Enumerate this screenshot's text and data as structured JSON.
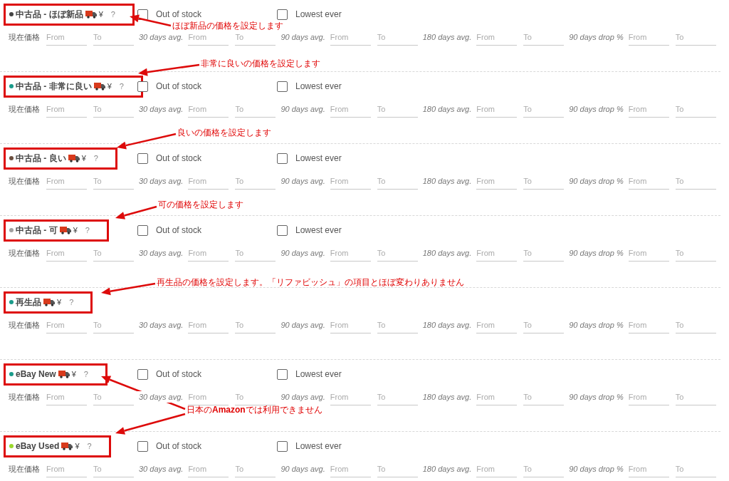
{
  "sections": [
    {
      "label": "中古品 - ほぼ新品",
      "color": "#444444",
      "currency": "¥",
      "help": "?",
      "out_of_stock": {
        "label": "Out of stock",
        "checked": false
      },
      "lowest_ever": {
        "label": "Lowest ever",
        "checked": false
      },
      "row_label": "現在価格",
      "ranges": [
        {
          "fields": [
            {
              "placeholder": "From"
            },
            {
              "placeholder": "To"
            }
          ]
        },
        {
          "label": "30 days avg.",
          "fields": [
            {
              "placeholder": "From"
            },
            {
              "placeholder": "To"
            }
          ]
        },
        {
          "label": "90 days avg.",
          "fields": [
            {
              "placeholder": "From"
            },
            {
              "placeholder": "To"
            }
          ]
        },
        {
          "label": "180 days avg.",
          "fields": [
            {
              "placeholder": "From"
            },
            {
              "placeholder": "To"
            }
          ]
        },
        {
          "label": "90 days drop %",
          "fields": [
            {
              "placeholder": "From"
            },
            {
              "placeholder": "To"
            }
          ]
        }
      ]
    },
    {
      "label": "中古品 - 非常に良い",
      "color": "#1a9b8a",
      "currency": "¥",
      "help": "?",
      "out_of_stock": {
        "label": "Out of stock",
        "checked": false
      },
      "lowest_ever": {
        "label": "Lowest ever",
        "checked": false
      },
      "row_label": "現在価格",
      "ranges": [
        {
          "fields": [
            {
              "placeholder": "From"
            },
            {
              "placeholder": "To"
            }
          ]
        },
        {
          "label": "30 days avg.",
          "fields": [
            {
              "placeholder": "From"
            },
            {
              "placeholder": "To"
            }
          ]
        },
        {
          "label": "90 days avg.",
          "fields": [
            {
              "placeholder": "From"
            },
            {
              "placeholder": "To"
            }
          ]
        },
        {
          "label": "180 days avg.",
          "fields": [
            {
              "placeholder": "From"
            },
            {
              "placeholder": "To"
            }
          ]
        },
        {
          "label": "90 days drop %",
          "fields": [
            {
              "placeholder": "From"
            },
            {
              "placeholder": "To"
            }
          ]
        }
      ]
    },
    {
      "label": "中古品 - 良い",
      "color": "#6b4f3f",
      "currency": "¥",
      "help": "?",
      "out_of_stock": {
        "label": "Out of stock",
        "checked": false
      },
      "lowest_ever": {
        "label": "Lowest ever",
        "checked": false
      },
      "row_label": "現在価格",
      "ranges": [
        {
          "fields": [
            {
              "placeholder": "From"
            },
            {
              "placeholder": "To"
            }
          ]
        },
        {
          "label": "30 days avg.",
          "fields": [
            {
              "placeholder": "From"
            },
            {
              "placeholder": "To"
            }
          ]
        },
        {
          "label": "90 days avg.",
          "fields": [
            {
              "placeholder": "From"
            },
            {
              "placeholder": "To"
            }
          ]
        },
        {
          "label": "180 days avg.",
          "fields": [
            {
              "placeholder": "From"
            },
            {
              "placeholder": "To"
            }
          ]
        },
        {
          "label": "90 days drop %",
          "fields": [
            {
              "placeholder": "From"
            },
            {
              "placeholder": "To"
            }
          ]
        }
      ]
    },
    {
      "label": "中古品 - 可",
      "color": "#a0a0a0",
      "currency": "¥",
      "help": "?",
      "out_of_stock": {
        "label": "Out of stock",
        "checked": false
      },
      "lowest_ever": {
        "label": "Lowest ever",
        "checked": false
      },
      "row_label": "現在価格",
      "ranges": [
        {
          "fields": [
            {
              "placeholder": "From"
            },
            {
              "placeholder": "To"
            }
          ]
        },
        {
          "label": "30 days avg.",
          "fields": [
            {
              "placeholder": "From"
            },
            {
              "placeholder": "To"
            }
          ]
        },
        {
          "label": "90 days avg.",
          "fields": [
            {
              "placeholder": "From"
            },
            {
              "placeholder": "To"
            }
          ]
        },
        {
          "label": "180 days avg.",
          "fields": [
            {
              "placeholder": "From"
            },
            {
              "placeholder": "To"
            }
          ]
        },
        {
          "label": "90 days drop %",
          "fields": [
            {
              "placeholder": "From"
            },
            {
              "placeholder": "To"
            }
          ]
        }
      ]
    },
    {
      "label": "再生品",
      "color": "#1a9b8a",
      "currency": "¥",
      "help": "?",
      "row_label": "現在価格",
      "ranges": [
        {
          "fields": [
            {
              "placeholder": "From"
            },
            {
              "placeholder": "To"
            }
          ]
        },
        {
          "label": "30 days avg.",
          "fields": [
            {
              "placeholder": "From"
            },
            {
              "placeholder": "To"
            }
          ]
        },
        {
          "label": "90 days avg.",
          "fields": [
            {
              "placeholder": "From"
            },
            {
              "placeholder": "To"
            }
          ]
        },
        {
          "label": "180 days avg.",
          "fields": [
            {
              "placeholder": "From"
            },
            {
              "placeholder": "To"
            }
          ]
        },
        {
          "label": "90 days drop %",
          "fields": [
            {
              "placeholder": "From"
            },
            {
              "placeholder": "To"
            }
          ]
        }
      ]
    },
    {
      "label": "eBay New",
      "color": "#1a9b8a",
      "currency": "¥",
      "help": "?",
      "out_of_stock": {
        "label": "Out of stock",
        "checked": false
      },
      "lowest_ever": {
        "label": "Lowest ever",
        "checked": false
      },
      "row_label": "現在価格",
      "ranges": [
        {
          "fields": [
            {
              "placeholder": "From"
            },
            {
              "placeholder": "To"
            }
          ]
        },
        {
          "label": "30 days avg.",
          "fields": [
            {
              "placeholder": "From"
            },
            {
              "placeholder": "To"
            }
          ]
        },
        {
          "label": "90 days avg.",
          "fields": [
            {
              "placeholder": "From"
            },
            {
              "placeholder": "To"
            }
          ]
        },
        {
          "label": "180 days avg.",
          "fields": [
            {
              "placeholder": "From"
            },
            {
              "placeholder": "To"
            }
          ]
        },
        {
          "label": "90 days drop %",
          "fields": [
            {
              "placeholder": "From"
            },
            {
              "placeholder": "To"
            }
          ]
        }
      ]
    },
    {
      "label": "eBay Used",
      "color": "#9ad82c",
      "currency": "¥",
      "help": "?",
      "out_of_stock": {
        "label": "Out of stock",
        "checked": false
      },
      "lowest_ever": {
        "label": "Lowest ever",
        "checked": false
      },
      "row_label": "現在価格",
      "ranges": [
        {
          "fields": [
            {
              "placeholder": "From"
            },
            {
              "placeholder": "To"
            }
          ]
        },
        {
          "label": "30 days avg.",
          "fields": [
            {
              "placeholder": "From"
            },
            {
              "placeholder": "To"
            }
          ]
        },
        {
          "label": "90 days avg.",
          "fields": [
            {
              "placeholder": "From"
            },
            {
              "placeholder": "To"
            }
          ]
        },
        {
          "label": "180 days avg.",
          "fields": [
            {
              "placeholder": "From"
            },
            {
              "placeholder": "To"
            }
          ]
        },
        {
          "label": "90 days drop %",
          "fields": [
            {
              "placeholder": "From"
            },
            {
              "placeholder": "To"
            }
          ]
        }
      ]
    }
  ],
  "annotations": [
    {
      "text": "ほぼ新品の価格を設定します"
    },
    {
      "text": "非常に良いの価格を設定します"
    },
    {
      "text": "良いの価格を設定します"
    },
    {
      "text": "可の価格を設定します"
    },
    {
      "text": "再生品の価格を設定します。「リファビッシュ」の項目とほぼ変わりありません"
    },
    {
      "text": "日本の**Amazon**では利用できません"
    }
  ]
}
